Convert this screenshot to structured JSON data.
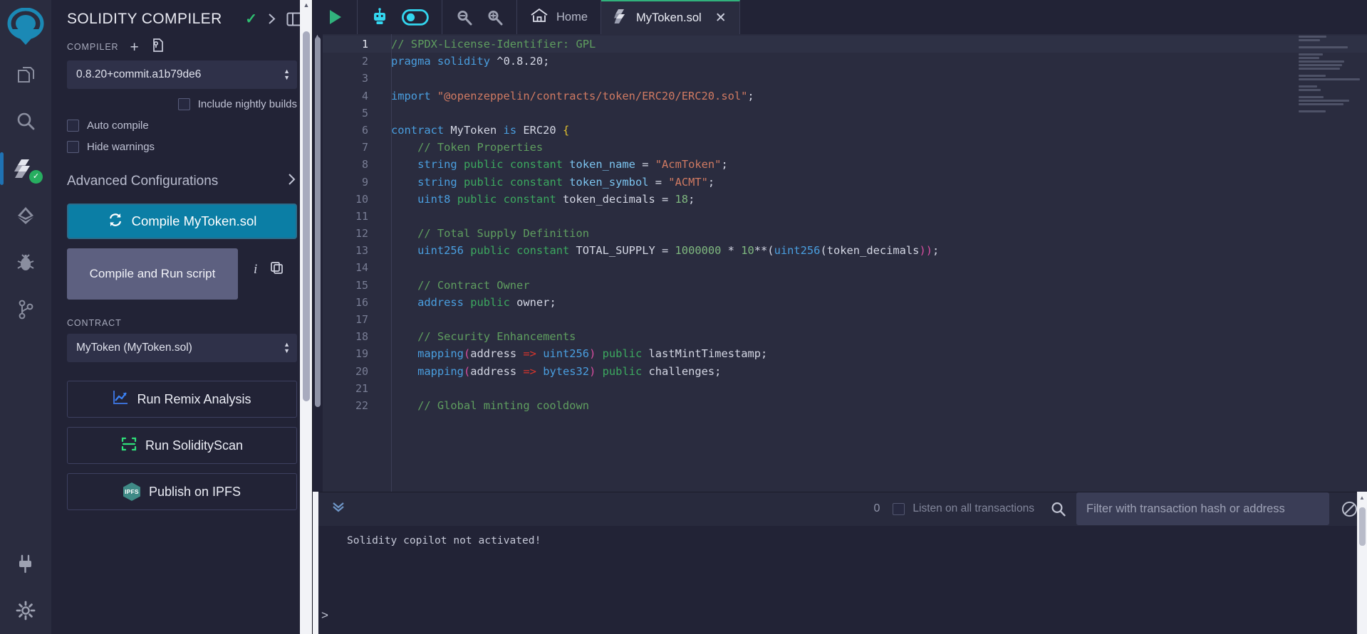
{
  "iconbar": {
    "items": [
      {
        "name": "remix-logo",
        "label": "Remix"
      },
      {
        "name": "file-explorer",
        "label": "File explorer"
      },
      {
        "name": "search",
        "label": "Search in files"
      },
      {
        "name": "solidity-compiler",
        "label": "Solidity compiler",
        "active": true,
        "badge": "✓"
      },
      {
        "name": "deploy-run",
        "label": "Deploy & run transactions"
      },
      {
        "name": "debugger",
        "label": "Debugger"
      },
      {
        "name": "git",
        "label": "Git"
      },
      {
        "name": "plugin-manager",
        "label": "Plugin manager"
      },
      {
        "name": "settings",
        "label": "Settings"
      }
    ]
  },
  "panel": {
    "title": "SOLIDITY COMPILER",
    "compiler_label": "COMPILER",
    "compiler_version": "0.8.20+commit.a1b79de6",
    "nightly_label": "Include nightly builds",
    "auto_compile_label": "Auto compile",
    "hide_warnings_label": "Hide warnings",
    "advanced_label": "Advanced Configurations",
    "compile_button": "Compile MyToken.sol",
    "compile_run_button": "Compile and Run script",
    "contract_label": "CONTRACT",
    "contract_value": "MyToken (MyToken.sol)",
    "remix_analysis_button": "Run Remix Analysis",
    "solidityscan_button": "Run SolidityScan",
    "ipfs_button": "Publish on IPFS",
    "ipfs_badge": "IPFS"
  },
  "topbar": {
    "expand_icon": "chevron-right-icon",
    "layout_icon": "layout-panel-icon",
    "run_icon": "play-icon",
    "copilot_icon": "robot-icon",
    "copilot_toggle": "toggle-on-icon",
    "zoom_out_icon": "zoom-out-icon",
    "zoom_in_icon": "zoom-in-icon",
    "home_label": "Home",
    "tabs": [
      {
        "label": "Home",
        "icon": "home-icon",
        "active": false,
        "closable": false
      },
      {
        "label": "MyToken.sol",
        "icon": "solidity-icon",
        "active": true,
        "closable": true,
        "close": "✕"
      }
    ]
  },
  "editor": {
    "lines": [
      {
        "n": "1",
        "current": true,
        "tokens": [
          {
            "t": "// SPDX-License-Identifier: GPL",
            "c": "t-com"
          }
        ]
      },
      {
        "n": "2",
        "tokens": [
          {
            "t": "pragma",
            "c": "t-kw"
          },
          {
            "t": " ",
            "c": "t-def"
          },
          {
            "t": "solidity",
            "c": "t-kw"
          },
          {
            "t": " ^0.8.20;",
            "c": "t-def"
          }
        ]
      },
      {
        "n": "3",
        "tokens": []
      },
      {
        "n": "4",
        "tokens": [
          {
            "t": "import",
            "c": "t-kw"
          },
          {
            "t": " ",
            "c": "t-def"
          },
          {
            "t": "\"@openzeppelin/contracts/token/ERC20/ERC20.sol\"",
            "c": "t-str"
          },
          {
            "t": ";",
            "c": "t-def"
          }
        ]
      },
      {
        "n": "5",
        "tokens": []
      },
      {
        "n": "6",
        "tokens": [
          {
            "t": "contract",
            "c": "t-kw"
          },
          {
            "t": " MyToken ",
            "c": "t-def"
          },
          {
            "t": "is",
            "c": "t-kw"
          },
          {
            "t": " ERC20 ",
            "c": "t-def"
          },
          {
            "t": "{",
            "c": "t-brace"
          }
        ]
      },
      {
        "n": "7",
        "tokens": [
          {
            "t": "    // Token Properties",
            "c": "t-com"
          }
        ]
      },
      {
        "n": "8",
        "tokens": [
          {
            "t": "    ",
            "c": "t-def"
          },
          {
            "t": "string",
            "c": "t-type"
          },
          {
            "t": " ",
            "c": "t-def"
          },
          {
            "t": "public",
            "c": "t-kw2"
          },
          {
            "t": " ",
            "c": "t-def"
          },
          {
            "t": "constant",
            "c": "t-kw2"
          },
          {
            "t": " ",
            "c": "t-def"
          },
          {
            "t": "token_name",
            "c": "t-var"
          },
          {
            "t": " = ",
            "c": "t-def"
          },
          {
            "t": "\"AcmToken\"",
            "c": "t-str"
          },
          {
            "t": ";",
            "c": "t-def"
          }
        ]
      },
      {
        "n": "9",
        "tokens": [
          {
            "t": "    ",
            "c": "t-def"
          },
          {
            "t": "string",
            "c": "t-type"
          },
          {
            "t": " ",
            "c": "t-def"
          },
          {
            "t": "public",
            "c": "t-kw2"
          },
          {
            "t": " ",
            "c": "t-def"
          },
          {
            "t": "constant",
            "c": "t-kw2"
          },
          {
            "t": " ",
            "c": "t-def"
          },
          {
            "t": "token_symbol",
            "c": "t-var"
          },
          {
            "t": " = ",
            "c": "t-def"
          },
          {
            "t": "\"ACMT\"",
            "c": "t-str"
          },
          {
            "t": ";",
            "c": "t-def"
          }
        ]
      },
      {
        "n": "10",
        "tokens": [
          {
            "t": "    ",
            "c": "t-def"
          },
          {
            "t": "uint8",
            "c": "t-type"
          },
          {
            "t": " ",
            "c": "t-def"
          },
          {
            "t": "public",
            "c": "t-kw2"
          },
          {
            "t": " ",
            "c": "t-def"
          },
          {
            "t": "constant",
            "c": "t-kw2"
          },
          {
            "t": " token_decimals = ",
            "c": "t-def"
          },
          {
            "t": "18",
            "c": "t-num"
          },
          {
            "t": ";",
            "c": "t-def"
          }
        ]
      },
      {
        "n": "11",
        "tokens": []
      },
      {
        "n": "12",
        "tokens": [
          {
            "t": "    // Total Supply Definition",
            "c": "t-com"
          }
        ]
      },
      {
        "n": "13",
        "tokens": [
          {
            "t": "    ",
            "c": "t-def"
          },
          {
            "t": "uint256",
            "c": "t-type"
          },
          {
            "t": " ",
            "c": "t-def"
          },
          {
            "t": "public",
            "c": "t-kw2"
          },
          {
            "t": " ",
            "c": "t-def"
          },
          {
            "t": "constant",
            "c": "t-kw2"
          },
          {
            "t": " TOTAL_SUPPLY = ",
            "c": "t-def"
          },
          {
            "t": "1000000",
            "c": "t-num"
          },
          {
            "t": " * ",
            "c": "t-def"
          },
          {
            "t": "10",
            "c": "t-num"
          },
          {
            "t": "**(",
            "c": "t-def"
          },
          {
            "t": "uint256",
            "c": "t-type"
          },
          {
            "t": "(token_decimals",
            "c": "t-def"
          },
          {
            "t": "))",
            "c": "t-paren"
          },
          {
            "t": ";",
            "c": "t-def"
          }
        ]
      },
      {
        "n": "14",
        "tokens": []
      },
      {
        "n": "15",
        "tokens": [
          {
            "t": "    // Contract Owner",
            "c": "t-com"
          }
        ]
      },
      {
        "n": "16",
        "tokens": [
          {
            "t": "    ",
            "c": "t-def"
          },
          {
            "t": "address",
            "c": "t-type"
          },
          {
            "t": " ",
            "c": "t-def"
          },
          {
            "t": "public",
            "c": "t-kw2"
          },
          {
            "t": " owner;",
            "c": "t-def"
          }
        ]
      },
      {
        "n": "17",
        "tokens": []
      },
      {
        "n": "18",
        "tokens": [
          {
            "t": "    // Security Enhancements",
            "c": "t-com"
          }
        ]
      },
      {
        "n": "19",
        "tokens": [
          {
            "t": "    ",
            "c": "t-def"
          },
          {
            "t": "mapping",
            "c": "t-kw"
          },
          {
            "t": "(",
            "c": "t-paren"
          },
          {
            "t": "address ",
            "c": "t-def"
          },
          {
            "t": "=>",
            "c": "t-arrow"
          },
          {
            "t": " ",
            "c": "t-def"
          },
          {
            "t": "uint256",
            "c": "t-type"
          },
          {
            "t": ")",
            "c": "t-paren"
          },
          {
            "t": " ",
            "c": "t-def"
          },
          {
            "t": "public",
            "c": "t-kw2"
          },
          {
            "t": " lastMintTimestamp;",
            "c": "t-def"
          }
        ]
      },
      {
        "n": "20",
        "tokens": [
          {
            "t": "    ",
            "c": "t-def"
          },
          {
            "t": "mapping",
            "c": "t-kw"
          },
          {
            "t": "(",
            "c": "t-paren"
          },
          {
            "t": "address ",
            "c": "t-def"
          },
          {
            "t": "=>",
            "c": "t-arrow"
          },
          {
            "t": " ",
            "c": "t-def"
          },
          {
            "t": "bytes32",
            "c": "t-type"
          },
          {
            "t": ")",
            "c": "t-paren"
          },
          {
            "t": " ",
            "c": "t-def"
          },
          {
            "t": "public",
            "c": "t-kw2"
          },
          {
            "t": " challenges;",
            "c": "t-def"
          }
        ]
      },
      {
        "n": "21",
        "tokens": []
      },
      {
        "n": "22",
        "tokens": [
          {
            "t": "    // Global minting cooldown",
            "c": "t-com"
          }
        ]
      }
    ]
  },
  "terminal": {
    "transaction_count": "0",
    "listen_label": "Listen on all transactions",
    "filter_placeholder": "Filter with transaction hash or address",
    "message": "Solidity copilot not activated!",
    "prompt": ">"
  },
  "colors": {
    "accent_blue": "#0b7ea5",
    "green_check": "#2fbf71",
    "cyan_icon": "#33d6ef",
    "play_green": "#31b27c"
  }
}
